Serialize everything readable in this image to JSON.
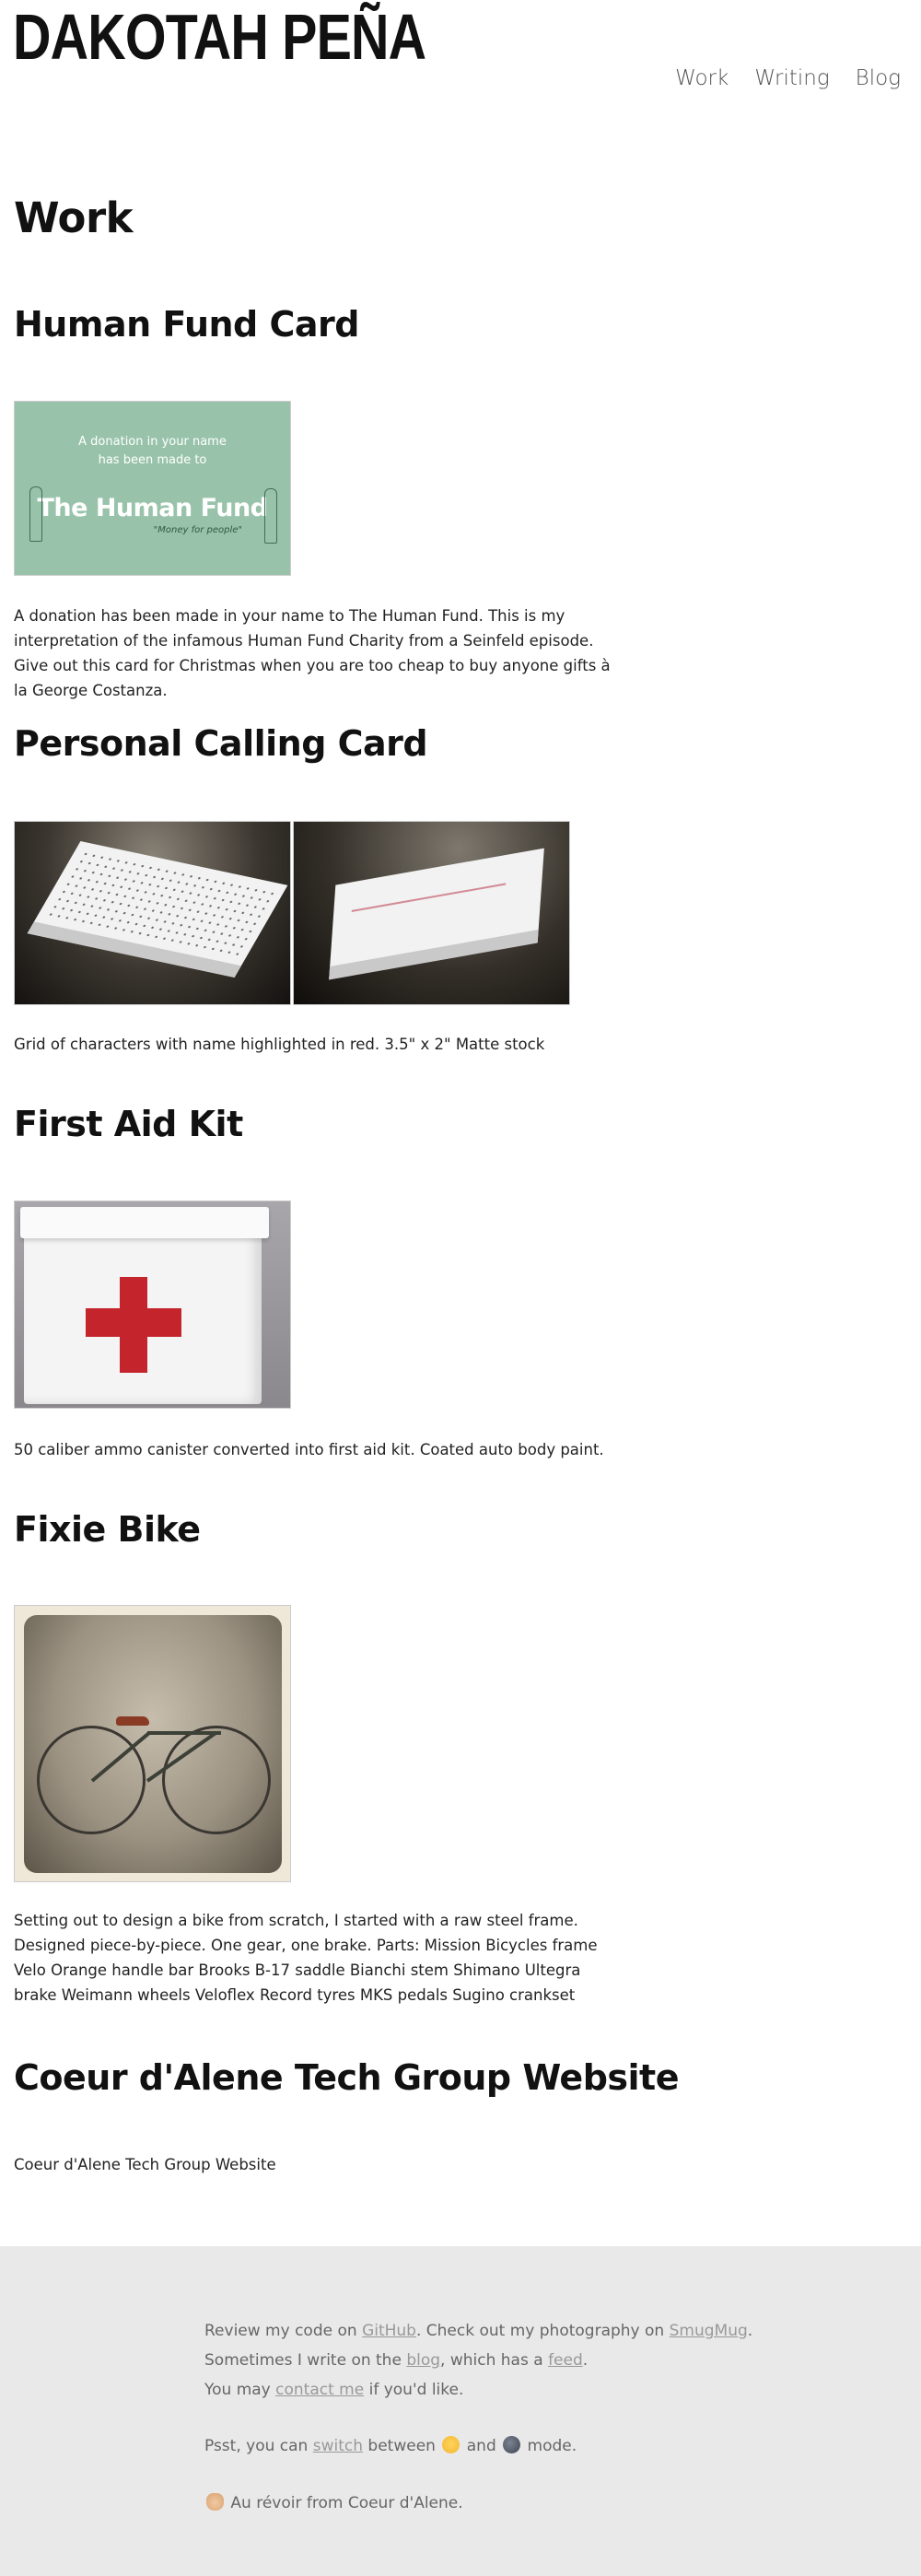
{
  "site": {
    "logo": "DAKOTAH PEÑA",
    "nav": [
      {
        "label": "Work"
      },
      {
        "label": "Writing"
      },
      {
        "label": "Blog"
      }
    ]
  },
  "main": {
    "page_title": "Work",
    "projects": [
      {
        "title": "Human Fund Card",
        "image_text": {
          "line1": "A donation in your name",
          "line2": "has been made to",
          "name": "The Human Fund",
          "tagline": "\"Money for people\""
        },
        "description": "A donation has been made in your name to The Human Fund. This is my interpretation of the infamous Human Fund Charity from a Seinfeld episode. Give out this card for Christmas when you are too cheap to buy anyone gifts à la George Costanza."
      },
      {
        "title": "Personal Calling Card",
        "description": "Grid of characters with name highlighted in red. 3.5\" x 2\" Matte stock"
      },
      {
        "title": "First Aid Kit",
        "description": "50 caliber ammo canister converted into first aid kit. Coated auto body paint."
      },
      {
        "title": "Fixie Bike",
        "description": "Setting out to design a bike from scratch, I started with a raw steel frame. Designed piece-by-piece. One gear, one brake. Parts: Mission Bicycles frame Velo Orange handle bar Brooks B-17 saddle Bianchi stem Shimano Ultegra brake Weimann wheels Veloflex Record tyres MKS pedals Sugino crankset"
      },
      {
        "title": "Coeur d'Alene Tech Group Website",
        "description": "Coeur d'Alene Tech Group Website"
      }
    ]
  },
  "footer": {
    "l1_a": "Review my code on ",
    "github": "GitHub",
    "l1_b": ". Check out my photography on ",
    "smugmug": "SmugMug",
    "l1_c": ".",
    "l2_a": "Sometimes I write on the ",
    "blog": "blog",
    "l2_b": ", which has a ",
    "feed": "feed",
    "l2_c": ".",
    "l3_a": "You may ",
    "contact": "contact me",
    "l3_b": " if you'd like.",
    "l4_a": "Psst, you can ",
    "switch": "switch",
    "l4_b": " between ",
    "l4_c": " and ",
    "l4_d": " mode.",
    "l5": " Au révoir from Coeur d'Alene.",
    "icons": {
      "light": "sun-face-emoji",
      "dark": "moon-face-emoji",
      "wave": "waving-hand-emoji"
    }
  }
}
